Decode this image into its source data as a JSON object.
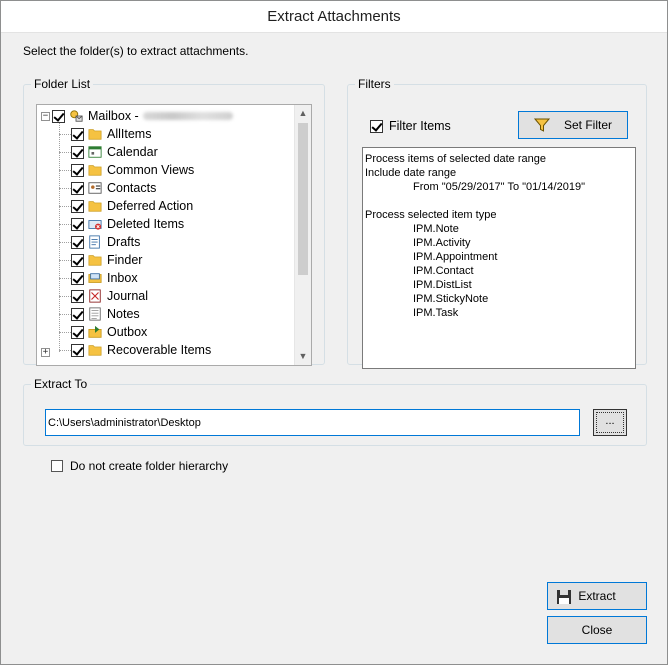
{
  "window": {
    "title": "Extract Attachments"
  },
  "instruction": "Select the folder(s) to extract attachments.",
  "folder_list": {
    "legend": "Folder List",
    "root": {
      "label": "Mailbox -",
      "expander": "−",
      "checked": true,
      "icon": "mailbox-icon"
    },
    "items": [
      {
        "label": "AllItems",
        "icon": "folder-icon",
        "checked": true
      },
      {
        "label": "Calendar",
        "icon": "calendar-icon",
        "checked": true
      },
      {
        "label": "Common Views",
        "icon": "folder-icon",
        "checked": true
      },
      {
        "label": "Contacts",
        "icon": "contacts-icon",
        "checked": true
      },
      {
        "label": "Deferred Action",
        "icon": "folder-icon",
        "checked": true
      },
      {
        "label": "Deleted Items",
        "icon": "deleted-items-icon",
        "checked": true
      },
      {
        "label": "Drafts",
        "icon": "drafts-icon",
        "checked": true
      },
      {
        "label": "Finder",
        "icon": "folder-icon",
        "checked": true
      },
      {
        "label": "Inbox",
        "icon": "inbox-icon",
        "checked": true
      },
      {
        "label": "Journal",
        "icon": "journal-icon",
        "checked": true
      },
      {
        "label": "Notes",
        "icon": "notes-icon",
        "checked": true
      },
      {
        "label": "Outbox",
        "icon": "outbox-icon",
        "checked": true
      },
      {
        "label": "Recoverable Items",
        "icon": "folder-icon",
        "checked": true,
        "expander": "+"
      }
    ]
  },
  "filters": {
    "legend": "Filters",
    "filter_items_label": "Filter Items",
    "filter_items_checked": true,
    "set_filter_label": "Set Filter",
    "summary": [
      "Process items of selected date range",
      "Include date range",
      "From \"05/29/2017\" To \"01/14/2019\"",
      "",
      "Process selected item type",
      "IPM.Note",
      "IPM.Activity",
      "IPM.Appointment",
      "IPM.Contact",
      "IPM.DistList",
      "IPM.StickyNote",
      "IPM.Task"
    ]
  },
  "extract_to": {
    "legend": "Extract To",
    "path": "C:\\Users\\administrator\\Desktop",
    "browse_label": "..."
  },
  "hierarchy_option": {
    "label": "Do not create folder hierarchy",
    "checked": false
  },
  "buttons": {
    "extract": "Extract",
    "close": "Close"
  },
  "colors": {
    "accent": "#0078d7",
    "folder": "#f5c242",
    "background": "#f0f0f0"
  }
}
